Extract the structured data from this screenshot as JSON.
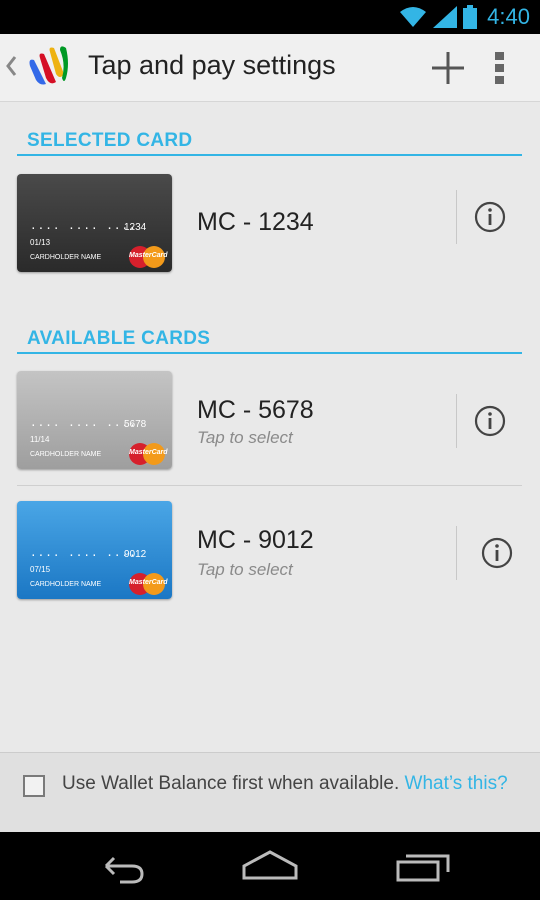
{
  "status_bar": {
    "time": "4:40",
    "icons": [
      "wifi-icon",
      "signal-icon",
      "battery-icon"
    ]
  },
  "action_bar": {
    "title": "Tap and pay settings",
    "icons": [
      "up-caret-icon",
      "wallet-logo-icon",
      "add-icon",
      "overflow-menu-icon"
    ]
  },
  "sections": {
    "selected_header": "SELECTED CARD",
    "available_header": "AVAILABLE CARDS"
  },
  "cards": [
    {
      "name": "MC - 1234",
      "subtitle": "",
      "dots": "···· ···· ····",
      "last4": "1234",
      "expiry": "01/13",
      "holder": "CARDHOLDER NAME",
      "brand": "MasterCard",
      "color": "#3a3a3a"
    },
    {
      "name": "MC - 5678",
      "subtitle": "Tap to select",
      "dots": "···· ···· ····",
      "last4": "5678",
      "expiry": "11/14",
      "holder": "CARDHOLDER NAME",
      "brand": "MasterCard",
      "color": "#b0b0b0"
    },
    {
      "name": "MC - 9012",
      "subtitle": "Tap to select",
      "dots": "···· ···· ····",
      "last4": "9012",
      "expiry": "07/15",
      "holder": "CARDHOLDER NAME",
      "brand": "MasterCard",
      "color": "#2a8dd4"
    }
  ],
  "wallet_balance": {
    "text": "Use Wallet Balance first when available.",
    "link": "What’s this?",
    "checked": false
  },
  "nav_bar": {
    "icons": [
      "back-icon",
      "home-icon",
      "recent-apps-icon"
    ]
  },
  "colors": {
    "accent": "#33b5e5",
    "background": "#e9e9e9"
  }
}
